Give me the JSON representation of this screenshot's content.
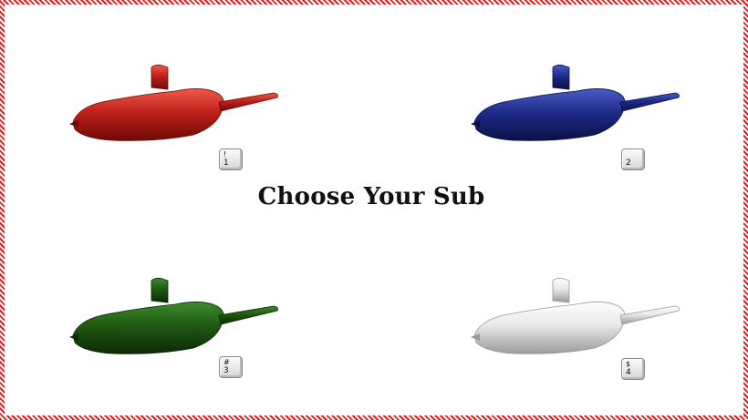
{
  "title": "Choose Your Sub",
  "options": [
    {
      "color_name": "red",
      "hull": "#c0201a",
      "hull_light": "#ef5a4a",
      "hull_dark": "#6e0a06",
      "key_top": "!",
      "key_bottom": "1"
    },
    {
      "color_name": "blue",
      "hull": "#1e2c8a",
      "hull_light": "#4a5cc4",
      "hull_dark": "#0a1046",
      "key_top": "",
      "key_bottom": "2"
    },
    {
      "color_name": "green",
      "hull": "#1f5a12",
      "hull_light": "#3e8a2c",
      "hull_dark": "#0b2a06",
      "key_top": "#",
      "key_bottom": "3"
    },
    {
      "color_name": "white",
      "hull": "#e8e8e8",
      "hull_light": "#ffffff",
      "hull_dark": "#9a9a9a",
      "key_top": "$",
      "key_bottom": "4"
    }
  ],
  "border_color": "#e02020"
}
